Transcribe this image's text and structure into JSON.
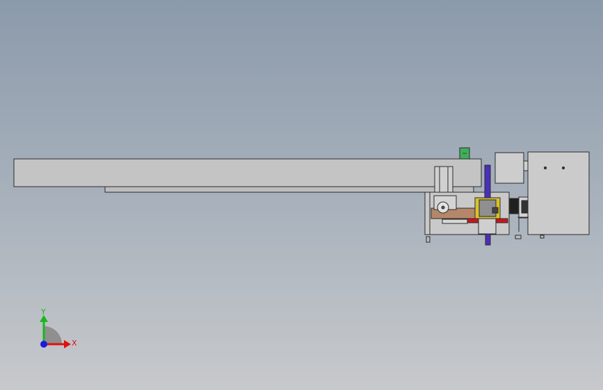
{
  "viewport": {
    "background_top": "#8b9aab",
    "background_bottom": "#c7c9cc"
  },
  "triad": {
    "x_label": "X",
    "y_label": "Y",
    "x_color": "#e01010",
    "y_color": "#18b818",
    "z_color": "#1a1ae0"
  },
  "colors": {
    "part_fill": "#c4c4c4",
    "part_stroke": "#2b2b2b",
    "brown": "#b4876a",
    "red": "#c8161c",
    "yellow": "#d8c22c",
    "blue_rod": "#4b2fb8",
    "green": "#3fae5a"
  }
}
